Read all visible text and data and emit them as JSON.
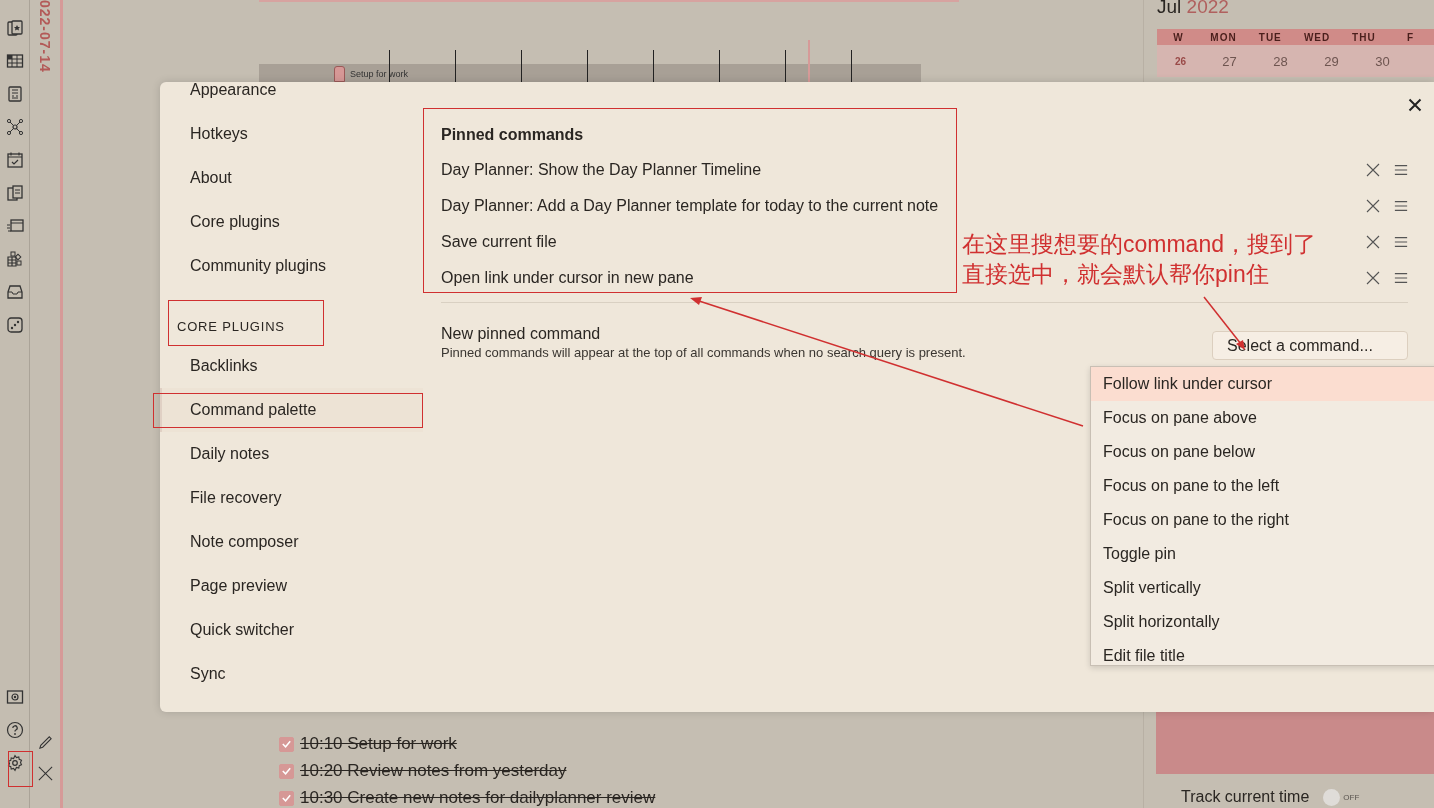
{
  "date_strip": {
    "date": "022-07-14"
  },
  "timeline": {
    "event": "Setup for work"
  },
  "calendar": {
    "month": "Jul",
    "year": "2022",
    "weekdays": [
      "W",
      "MON",
      "TUE",
      "WED",
      "THU",
      "F"
    ],
    "days": [
      "26",
      "27",
      "28",
      "29",
      "30"
    ]
  },
  "tasks": [
    {
      "text": "10:10 Setup for work",
      "checked": true
    },
    {
      "text": "10:20 Review notes from yesterday",
      "checked": true
    },
    {
      "text": "10:30 Create new notes for dailyplanner review",
      "checked": true
    }
  ],
  "track_time": {
    "label": "Track current time",
    "on": false,
    "state_label": "OFF"
  },
  "settings": {
    "nav": [
      {
        "label": "Appearance",
        "selected": false
      },
      {
        "label": "Hotkeys",
        "selected": false
      },
      {
        "label": "About",
        "selected": false
      },
      {
        "label": "Core plugins",
        "selected": false
      },
      {
        "label": "Community plugins",
        "selected": false
      }
    ],
    "section_heading": "CORE PLUGINS",
    "plugin_nav": [
      {
        "label": "Backlinks",
        "selected": false
      },
      {
        "label": "Command palette",
        "selected": true
      },
      {
        "label": "Daily notes",
        "selected": false
      },
      {
        "label": "File recovery",
        "selected": false
      },
      {
        "label": "Note composer",
        "selected": false
      },
      {
        "label": "Page preview",
        "selected": false
      },
      {
        "label": "Quick switcher",
        "selected": false
      },
      {
        "label": "Sync",
        "selected": false
      }
    ],
    "pinned_heading": "Pinned commands",
    "pinned_commands": [
      "Day Planner: Show the Day Planner Timeline",
      "Day Planner: Add a Day Planner template for today to the current note",
      "Save current file",
      "Open link under cursor in new pane"
    ],
    "new_pinned": {
      "label": "New pinned command",
      "description": "Pinned commands will appear at the top of all commands when no search query is present.",
      "select_button": "Select a command..."
    },
    "dropdown": [
      {
        "label": "Follow link under cursor",
        "selected": true
      },
      {
        "label": "Focus on pane above",
        "selected": false
      },
      {
        "label": "Focus on pane below",
        "selected": false
      },
      {
        "label": "Focus on pane to the left",
        "selected": false
      },
      {
        "label": "Focus on pane to the right",
        "selected": false
      },
      {
        "label": "Toggle pin",
        "selected": false
      },
      {
        "label": "Split vertically",
        "selected": false
      },
      {
        "label": "Split horizontally",
        "selected": false
      },
      {
        "label": "Edit file title",
        "selected": false
      }
    ]
  },
  "annotation": {
    "lines": [
      "在这里搜想要的command，搜到了",
      "直接选中，就会默认帮你pin住"
    ]
  }
}
